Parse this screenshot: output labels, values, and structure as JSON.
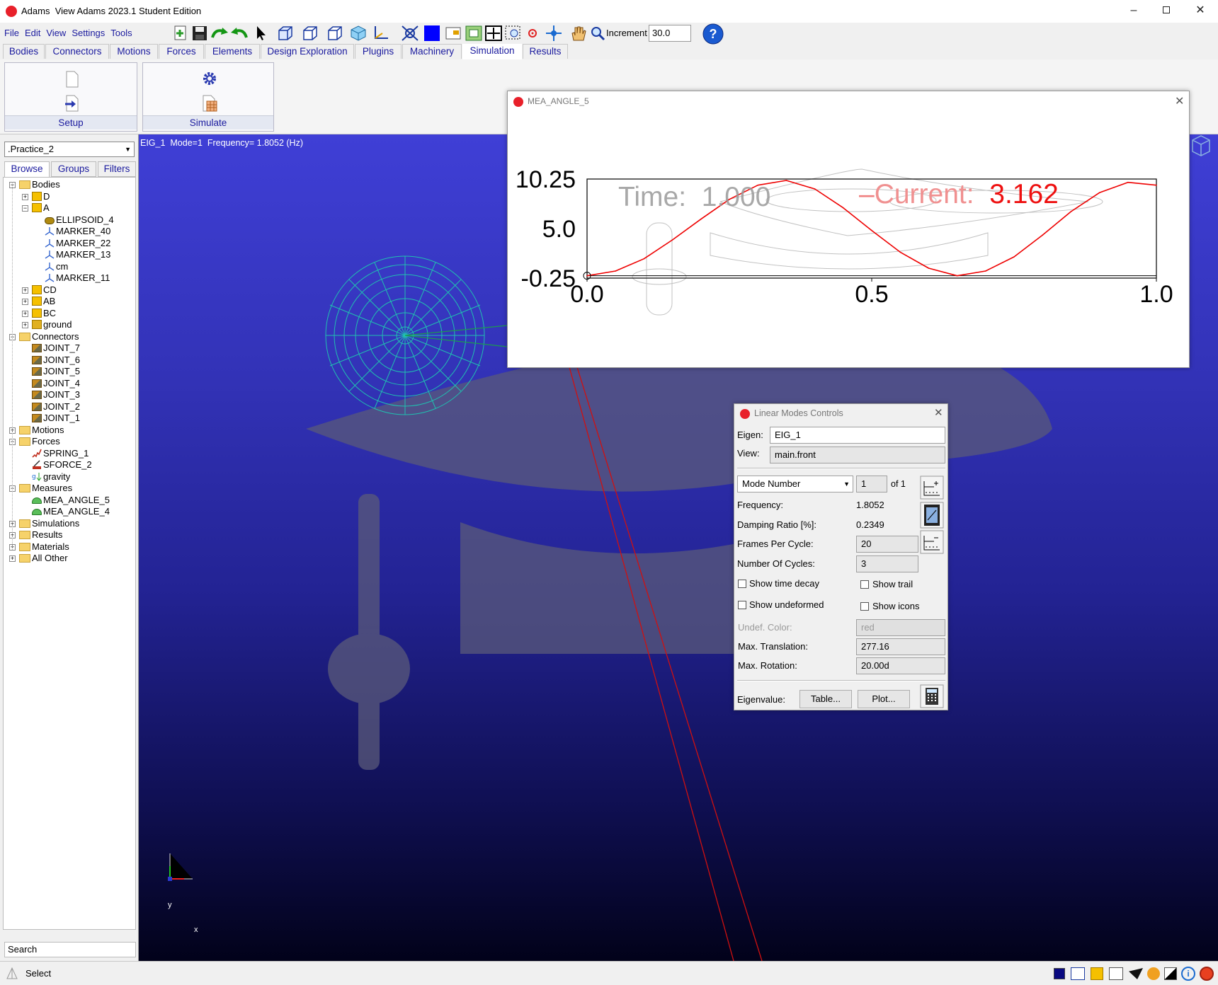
{
  "window": {
    "app_name": "Adams",
    "title": "View Adams 2023.1 Student Edition"
  },
  "menu": [
    "File",
    "Edit",
    "View",
    "Settings",
    "Tools"
  ],
  "toolbar": {
    "increment_label": "Increment",
    "increment_value": "30.0"
  },
  "tabs": [
    "Bodies",
    "Connectors",
    "Motions",
    "Forces",
    "Elements",
    "Design Exploration",
    "Plugins",
    "Machinery",
    "Simulation",
    "Results"
  ],
  "ribbon": {
    "setup_label": "Setup",
    "simulate_label": "Simulate"
  },
  "browser": {
    "model": ".Practice_2",
    "tabs": [
      "Browse",
      "Groups",
      "Filters"
    ],
    "search_placeholder": "Search",
    "tree": [
      {
        "label": "Bodies",
        "icon": "folder",
        "level": 0,
        "toggle": "-"
      },
      {
        "label": "D",
        "icon": "body",
        "level": 1,
        "toggle": "+"
      },
      {
        "label": "A",
        "icon": "body",
        "level": 1,
        "toggle": "-"
      },
      {
        "label": "ELLIPSOID_4",
        "icon": "ellipsoid",
        "level": 2,
        "toggle": ""
      },
      {
        "label": "MARKER_40",
        "icon": "marker",
        "level": 2,
        "toggle": ""
      },
      {
        "label": "MARKER_22",
        "icon": "marker",
        "level": 2,
        "toggle": ""
      },
      {
        "label": "MARKER_13",
        "icon": "marker",
        "level": 2,
        "toggle": ""
      },
      {
        "label": "cm",
        "icon": "marker",
        "level": 2,
        "toggle": ""
      },
      {
        "label": "MARKER_11",
        "icon": "marker",
        "level": 2,
        "toggle": ""
      },
      {
        "label": "CD",
        "icon": "body",
        "level": 1,
        "toggle": "+"
      },
      {
        "label": "AB",
        "icon": "body",
        "level": 1,
        "toggle": "+"
      },
      {
        "label": "BC",
        "icon": "body",
        "level": 1,
        "toggle": "+"
      },
      {
        "label": "ground",
        "icon": "ground",
        "level": 1,
        "toggle": "+"
      },
      {
        "label": "Connectors",
        "icon": "folder",
        "level": 0,
        "toggle": "-"
      },
      {
        "label": "JOINT_7",
        "icon": "joint",
        "level": 1,
        "toggle": ""
      },
      {
        "label": "JOINT_6",
        "icon": "joint",
        "level": 1,
        "toggle": ""
      },
      {
        "label": "JOINT_5",
        "icon": "joint",
        "level": 1,
        "toggle": ""
      },
      {
        "label": "JOINT_4",
        "icon": "joint",
        "level": 1,
        "toggle": ""
      },
      {
        "label": "JOINT_3",
        "icon": "joint",
        "level": 1,
        "toggle": ""
      },
      {
        "label": "JOINT_2",
        "icon": "joint",
        "level": 1,
        "toggle": ""
      },
      {
        "label": "JOINT_1",
        "icon": "joint",
        "level": 1,
        "toggle": ""
      },
      {
        "label": "Motions",
        "icon": "folder",
        "level": 0,
        "toggle": "+"
      },
      {
        "label": "Forces",
        "icon": "folder",
        "level": 0,
        "toggle": "-"
      },
      {
        "label": "SPRING_1",
        "icon": "spring",
        "level": 1,
        "toggle": ""
      },
      {
        "label": "SFORCE_2",
        "icon": "sforce",
        "level": 1,
        "toggle": ""
      },
      {
        "label": "gravity",
        "icon": "gravity",
        "level": 1,
        "toggle": ""
      },
      {
        "label": "Measures",
        "icon": "folder",
        "level": 0,
        "toggle": "-"
      },
      {
        "label": "MEA_ANGLE_5",
        "icon": "measure",
        "level": 1,
        "toggle": ""
      },
      {
        "label": "MEA_ANGLE_4",
        "icon": "measure",
        "level": 1,
        "toggle": ""
      },
      {
        "label": "Simulations",
        "icon": "folder",
        "level": 0,
        "toggle": "+"
      },
      {
        "label": "Results",
        "icon": "folder",
        "level": 0,
        "toggle": "+"
      },
      {
        "label": "Materials",
        "icon": "folder",
        "level": 0,
        "toggle": "+"
      },
      {
        "label": "All Other",
        "icon": "folder",
        "level": 0,
        "toggle": "+"
      }
    ]
  },
  "viewport": {
    "info": "EIG_1  Mode=1  Frequency= 1.8052 (Hz)",
    "axis_y": "y",
    "axis_x": "x"
  },
  "status": {
    "text": "Select"
  },
  "plot_window": {
    "title": "MEA_ANGLE_5",
    "time_label": "Time:",
    "time_value": "1.000",
    "current_label": "Current:",
    "current_value": "3.162"
  },
  "chart_data": {
    "type": "line",
    "ylim": [
      -0.25,
      10.25
    ],
    "xlim": [
      0.0,
      1.0
    ],
    "yticks": [
      "10.25",
      "5.0",
      "-0.25"
    ],
    "xticks": [
      "0.0",
      "0.5",
      "1.0"
    ],
    "series": [
      {
        "color": "#ee0000",
        "x": [
          0.0,
          0.05,
          0.1,
          0.15,
          0.2,
          0.25,
          0.3,
          0.35,
          0.4,
          0.45,
          0.5,
          0.55,
          0.6,
          0.65,
          0.7,
          0.75,
          0.8,
          0.85,
          0.9,
          0.95,
          1.0
        ],
        "y": [
          0.0,
          0.5,
          1.8,
          3.8,
          6.0,
          8.1,
          9.6,
          10.1,
          9.2,
          7.2,
          4.8,
          2.5,
          0.8,
          0.0,
          0.5,
          2.0,
          4.3,
          6.8,
          8.8,
          9.9,
          9.6
        ]
      }
    ]
  },
  "modes": {
    "title": "Linear Modes Controls",
    "eigen_label": "Eigen:",
    "eigen_value": "EIG_1",
    "view_label": "View:",
    "view_value": "main.front",
    "mode_select": "Mode Number",
    "mode_value": "1",
    "mode_of": "of 1",
    "frequency_label": "Frequency:",
    "frequency_value": "1.8052",
    "damping_label": "Damping Ratio [%]:",
    "damping_value": "0.2349",
    "fpc_label": "Frames Per Cycle:",
    "fpc_value": "20",
    "cycles_label": "Number Of Cycles:",
    "cycles_value": "3",
    "show_time_decay": "Show time decay",
    "show_trail": "Show trail",
    "show_undeformed": "Show undeformed",
    "show_icons": "Show icons",
    "undef_color_label": "Undef. Color:",
    "undef_color_value": "red",
    "max_translation_label": "Max. Translation:",
    "max_translation_value": "277.16",
    "max_rotation_label": "Max. Rotation:",
    "max_rotation_value": "20.00d",
    "eigenvalue_label": "Eigenvalue:",
    "table_button": "Table...",
    "plot_button": "Plot..."
  }
}
